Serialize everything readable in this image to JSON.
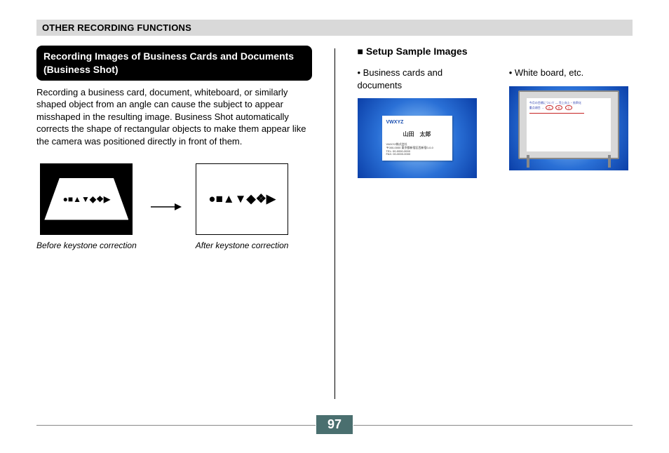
{
  "header": "OTHER RECORDING FUNCTIONS",
  "left": {
    "section_title": "Recording Images of Business Cards and Documents (Business Shot)",
    "body": "Recording a business card, document, whiteboard, or similarly shaped object from an angle can cause the subject to appear misshaped in the resulting image. Business Shot automatically corrects the shape of rectangular objects to make them appear like the camera was positioned directly in front of them.",
    "before_caption": "Before keystone correction",
    "after_caption": "After keystone correction",
    "shapes_glyphs": "●■▲▼◆❖▶"
  },
  "right": {
    "heading": "■ Setup Sample Images",
    "sample1_label": "• Business cards and documents",
    "sample2_label": "• White board, etc.",
    "bizcard": {
      "logo": "VWXYZ",
      "name": "山田　太郎",
      "addr": "VWXYZ株式会社\n〒000-0000 東京都新宿区西新宿0-0-0\nTEL: 00-0000-0000\nFAX: 00-0000-0000"
    },
    "whiteboard_text": "今月の目標について — 売上向上・効率化\n重点項目 →"
  },
  "page_number": "97"
}
